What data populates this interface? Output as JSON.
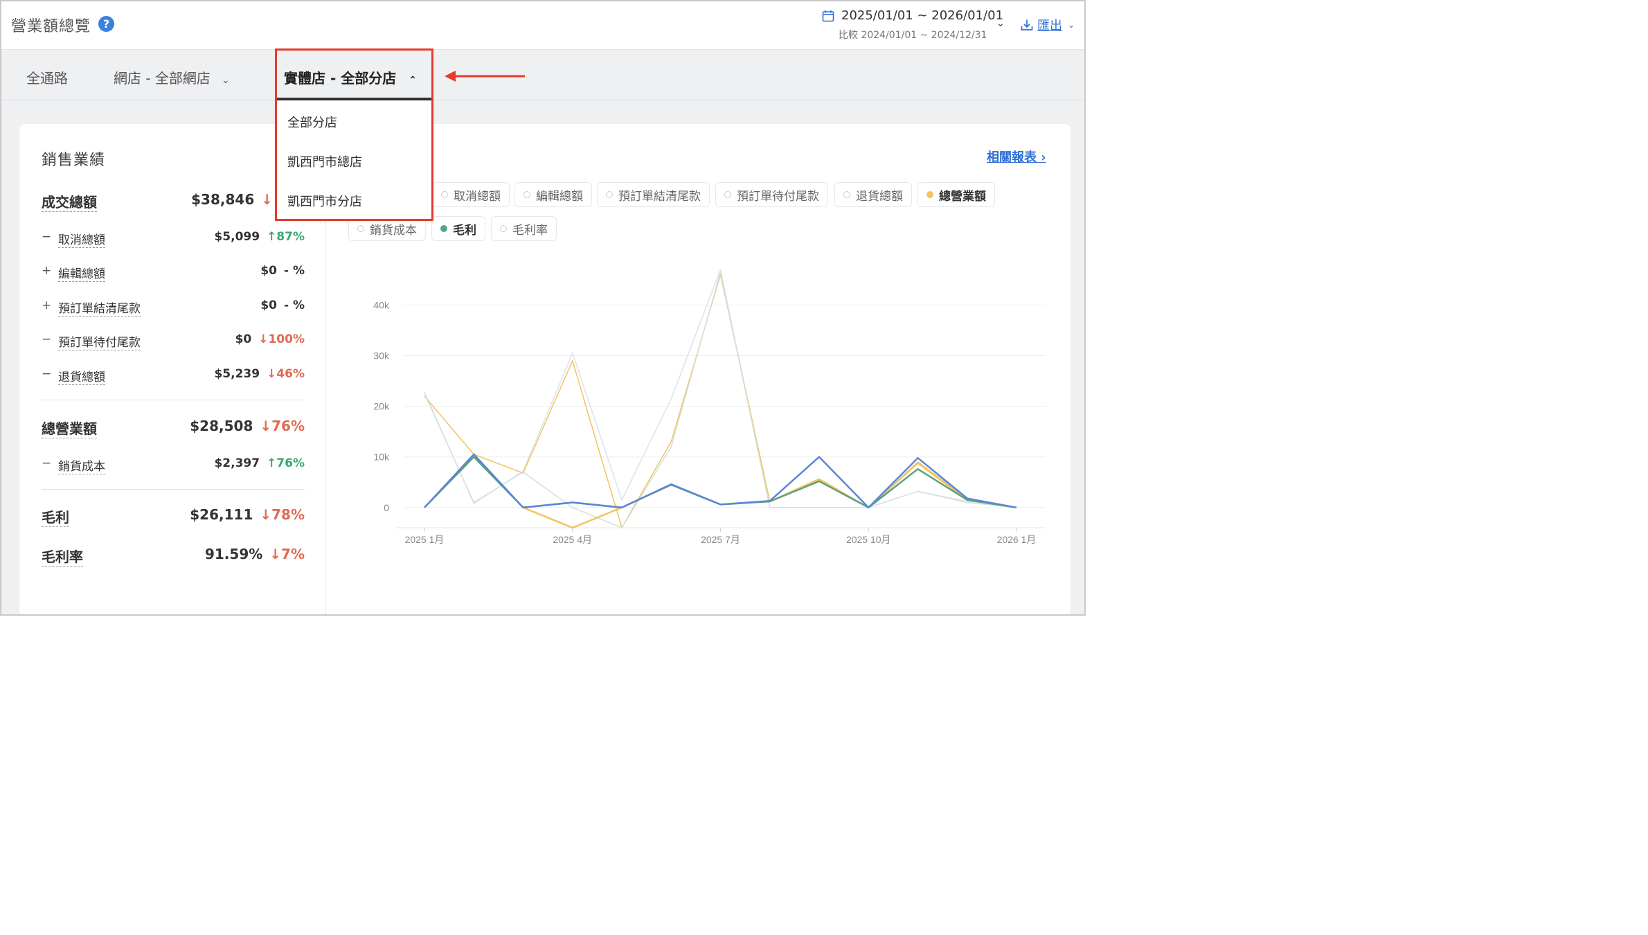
{
  "header": {
    "title": "營業額總覽",
    "help_icon": "?",
    "date_range": "2025/01/01 ~ 2026/01/01",
    "compare": "比較 2024/01/01 ~ 2024/12/31",
    "export_label": "匯出"
  },
  "tabs": {
    "all": "全通路",
    "online": "網店 - 全部網店",
    "store": "實體店 - 全部分店"
  },
  "dropdown": {
    "items": [
      "全部分店",
      "凱西門市總店",
      "凱西門市分店"
    ]
  },
  "panel": {
    "section_title": "銷售業績",
    "report_link": "相關報表 ›",
    "metrics": [
      {
        "label": "成交總額",
        "value": "$38,846",
        "pct": "↓",
        "dir": "down",
        "sign": ""
      },
      {
        "label": "取消總額",
        "value": "$5,099",
        "pct": "↑87%",
        "dir": "up",
        "sign": "−"
      },
      {
        "label": "編輯總額",
        "value": "$0",
        "pct": "- %",
        "dir": "flat",
        "sign": "+"
      },
      {
        "label": "預訂單結清尾款",
        "value": "$0",
        "pct": "- %",
        "dir": "flat",
        "sign": "+"
      },
      {
        "label": "預訂單待付尾款",
        "value": "$0",
        "pct": "↓100%",
        "dir": "down",
        "sign": "−"
      },
      {
        "label": "退貨總額",
        "value": "$5,239",
        "pct": "↓46%",
        "dir": "down",
        "sign": "−"
      },
      {
        "label": "總營業額",
        "value": "$28,508",
        "pct": "↓76%",
        "dir": "down",
        "sign": ""
      },
      {
        "label": "銷貨成本",
        "value": "$2,397",
        "pct": "↑76%",
        "dir": "up",
        "sign": "−"
      },
      {
        "label": "毛利",
        "value": "$26,111",
        "pct": "↓78%",
        "dir": "down",
        "sign": ""
      },
      {
        "label": "毛利率",
        "value": "91.59%",
        "pct": "↓7%",
        "dir": "down",
        "sign": ""
      }
    ]
  },
  "chips": [
    {
      "label": "取消總額",
      "active": false,
      "color": "#ffffff"
    },
    {
      "label": "編輯總額",
      "active": false,
      "color": "#ffffff"
    },
    {
      "label": "預訂單結清尾款",
      "active": false,
      "color": "#ffffff"
    },
    {
      "label": "預訂單待付尾款",
      "active": false,
      "color": "#ffffff"
    },
    {
      "label": "退貨總額",
      "active": false,
      "color": "#ffffff"
    },
    {
      "label": "總營業額",
      "active": true,
      "color": "#f2c45c"
    },
    {
      "label": "銷貨成本",
      "active": false,
      "color": "#ffffff"
    },
    {
      "label": "毛利",
      "active": true,
      "color": "#5aa37e"
    },
    {
      "label": "毛利率",
      "active": false,
      "color": "#ffffff"
    }
  ],
  "chart_data": {
    "type": "line",
    "x": [
      "2025-01",
      "2025-02",
      "2025-03",
      "2025-04",
      "2025-05",
      "2025-06",
      "2025-07",
      "2025-08",
      "2025-09",
      "2025-10",
      "2025-11",
      "2025-12",
      "2026-01"
    ],
    "x_tick_labels": [
      "2025 1月",
      "2025 4月",
      "2025 7月",
      "2025 10月",
      "2026 1月"
    ],
    "x_tick_indices": [
      0,
      3,
      6,
      9,
      12
    ],
    "y_tick_labels": [
      "0",
      "10k",
      "20k",
      "30k",
      "40k"
    ],
    "ylim": [
      -4000,
      48000
    ],
    "grid": true,
    "series": [
      {
        "color": "#d9e3f2",
        "values": [
          22800,
          800,
          7200,
          30500,
          1500,
          21500,
          47000,
          0,
          0,
          0,
          3200,
          1200,
          0
        ]
      },
      {
        "color": "#f2c45c",
        "values": [
          22000,
          10500,
          6800,
          29000,
          -4000,
          13000,
          46000,
          1200,
          5500,
          0,
          9000,
          1800,
          0
        ]
      },
      {
        "color": "#d5dfe0",
        "values": [
          22500,
          1000,
          7000,
          0,
          -4000,
          12000,
          46500,
          0,
          0,
          0,
          3200,
          1000,
          0
        ]
      },
      {
        "name": "總營業額",
        "color": "#f2c45c",
        "values": [
          0,
          10300,
          0,
          -4000,
          0,
          4500,
          600,
          1200,
          5600,
          0,
          8800,
          1500,
          0
        ]
      },
      {
        "name": "毛利",
        "color": "#5aa37e",
        "values": [
          0,
          10000,
          0,
          1000,
          0,
          4500,
          600,
          1200,
          5200,
          0,
          7600,
          1500,
          0
        ]
      },
      {
        "color": "#5b86d6",
        "values": [
          0,
          10500,
          0,
          1000,
          0,
          4600,
          600,
          1300,
          10000,
          0,
          9800,
          1800,
          0
        ]
      }
    ]
  }
}
